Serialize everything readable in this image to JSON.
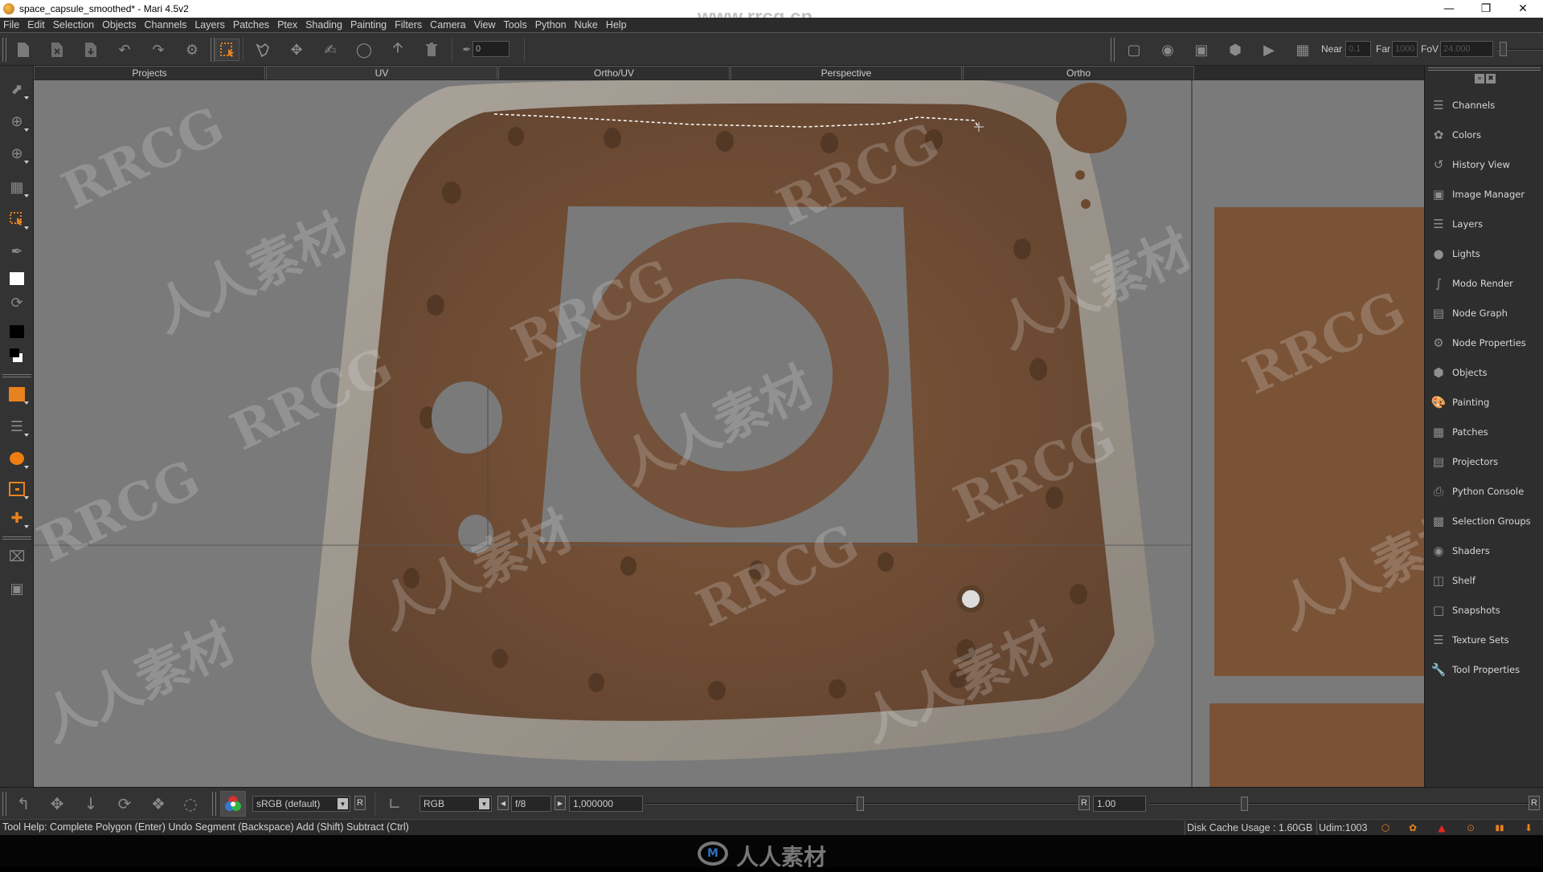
{
  "window": {
    "title": "space_capsule_smoothed* - Mari 4.5v2",
    "controls": [
      "minimize",
      "maximize",
      "close"
    ]
  },
  "menu": [
    "File",
    "Edit",
    "Selection",
    "Objects",
    "Channels",
    "Layers",
    "Patches",
    "Ptex",
    "Shading",
    "Painting",
    "Filters",
    "Camera",
    "View",
    "Tools",
    "Python",
    "Nuke",
    "Help"
  ],
  "toolbar": {
    "left_icons": [
      "new-project-icon",
      "close-project-icon",
      "save-project-icon",
      "undo-icon",
      "redo-icon",
      "project-settings-icon"
    ],
    "selection_icons": [
      "marquee-select-icon",
      "lasso-select-icon",
      "transform-icon",
      "paint-through-icon",
      "mask-icon",
      "arrow-up-icon",
      "trash-icon"
    ],
    "brush_value": "0",
    "view_icons": [
      "bounding-box-icon",
      "camera-view-icon",
      "frame-selection-icon",
      "shade-icon",
      "projector-icon",
      "stencil-icon"
    ],
    "near_label": "Near",
    "near_value": "0.1",
    "far_label": "Far",
    "far_value": "1000",
    "fov_label": "FoV",
    "fov_value": "24.000"
  },
  "tabs": [
    {
      "label": "Projects",
      "active": false
    },
    {
      "label": "UV",
      "active": true
    },
    {
      "label": "Ortho/UV",
      "active": false
    },
    {
      "label": "Perspective",
      "active": false
    },
    {
      "label": "Ortho",
      "active": false
    }
  ],
  "left_tools": [
    "select-icon",
    "paint-icon",
    "paint-airbrush-icon",
    "grid-paint-icon",
    "marquee-select-icon",
    "eyedropper-icon",
    "foreground-color-swatch",
    "swap-colors-icon",
    "background-color-swatch",
    "color-reset-icon",
    "layer-select-icon",
    "visibility-layers-icon",
    "sphere-icon",
    "patch-select-icon",
    "add-projector-icon",
    "clear-icon",
    "frame-icon"
  ],
  "viewport": {
    "background_color": "#7a7a7a",
    "texture_color": "#7a5236",
    "selection_line_color": "#ffffff"
  },
  "palettes": [
    {
      "label": "Channels",
      "icon": "channels-icon"
    },
    {
      "label": "Colors",
      "icon": "colors-icon"
    },
    {
      "label": "History View",
      "icon": "history-icon"
    },
    {
      "label": "Image Manager",
      "icon": "image-manager-icon"
    },
    {
      "label": "Layers",
      "icon": "layers-icon"
    },
    {
      "label": "Lights",
      "icon": "lights-icon"
    },
    {
      "label": "Modo Render",
      "icon": "modo-render-icon"
    },
    {
      "label": "Node Graph",
      "icon": "node-graph-icon"
    },
    {
      "label": "Node Properties",
      "icon": "node-properties-icon"
    },
    {
      "label": "Objects",
      "icon": "objects-icon"
    },
    {
      "label": "Painting",
      "icon": "painting-icon"
    },
    {
      "label": "Patches",
      "icon": "patches-icon"
    },
    {
      "label": "Projectors",
      "icon": "projectors-icon"
    },
    {
      "label": "Python Console",
      "icon": "python-console-icon"
    },
    {
      "label": "Selection Groups",
      "icon": "selection-groups-icon"
    },
    {
      "label": "Shaders",
      "icon": "shaders-icon"
    },
    {
      "label": "Shelf",
      "icon": "shelf-icon"
    },
    {
      "label": "Snapshots",
      "icon": "snapshots-icon"
    },
    {
      "label": "Texture Sets",
      "icon": "texture-sets-icon"
    },
    {
      "label": "Tool Properties",
      "icon": "tool-properties-icon"
    }
  ],
  "bottom_toolbar": {
    "colorspace": "sRGB (default)",
    "reset_label": "R",
    "channel_mode": "RGB",
    "fstop": "f/8",
    "exposure": "1,000000",
    "gain_value": "1.00"
  },
  "status": {
    "tool_help": "Tool Help: Complete Polygon (Enter)   Undo Segment (Backspace)   Add (Shift)   Subtract (Ctrl)",
    "disk_cache": "Disk Cache Usage : 1.60GB",
    "udim": "Udim:1003"
  },
  "watermarks": {
    "rrcg": "RRCG",
    "cn": "人人素材",
    "site": "www.rrcg.cn"
  }
}
